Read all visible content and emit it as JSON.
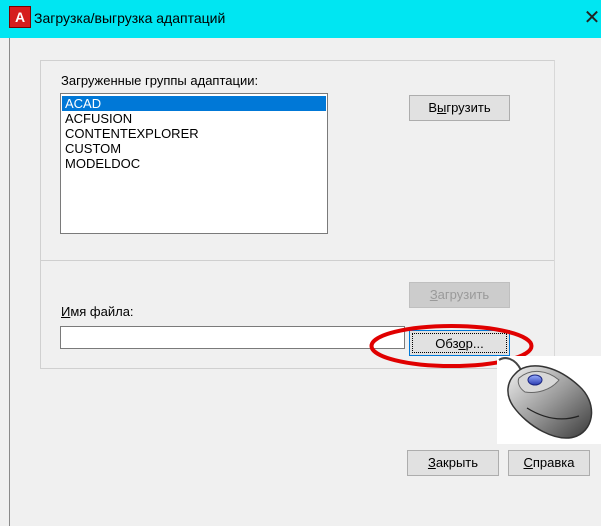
{
  "window": {
    "title": "Загрузка/выгрузка адаптаций",
    "app_icon_letter": "A",
    "close_glyph": "✕"
  },
  "groups": {
    "label": "Загруженные группы адаптации:",
    "items": [
      {
        "label": "ACAD",
        "selected": true
      },
      {
        "label": "ACFUSION",
        "selected": false
      },
      {
        "label": "CONTENTEXPLORER",
        "selected": false
      },
      {
        "label": "CUSTOM",
        "selected": false
      },
      {
        "label": "MODELDOC",
        "selected": false
      }
    ],
    "unload": {
      "before": "В",
      "key": "ы",
      "after": "грузить"
    }
  },
  "file": {
    "label": {
      "before": "",
      "key": "И",
      "after": "мя файла:"
    },
    "value": "",
    "load": {
      "before": "",
      "key": "З",
      "after": "агрузить"
    },
    "browse": {
      "before": "Обз",
      "key": "о",
      "after": "р..."
    }
  },
  "footer": {
    "close": {
      "before": "",
      "key": "З",
      "after": "акрыть"
    },
    "help": {
      "before": "",
      "key": "С",
      "after": "правка"
    }
  },
  "colors": {
    "titlebar": "#00e6f2",
    "selection": "#0078d7",
    "highlight_ellipse": "#e00000"
  },
  "icons": [
    "autocad-app-icon",
    "close-icon",
    "computer-mouse-icon"
  ]
}
